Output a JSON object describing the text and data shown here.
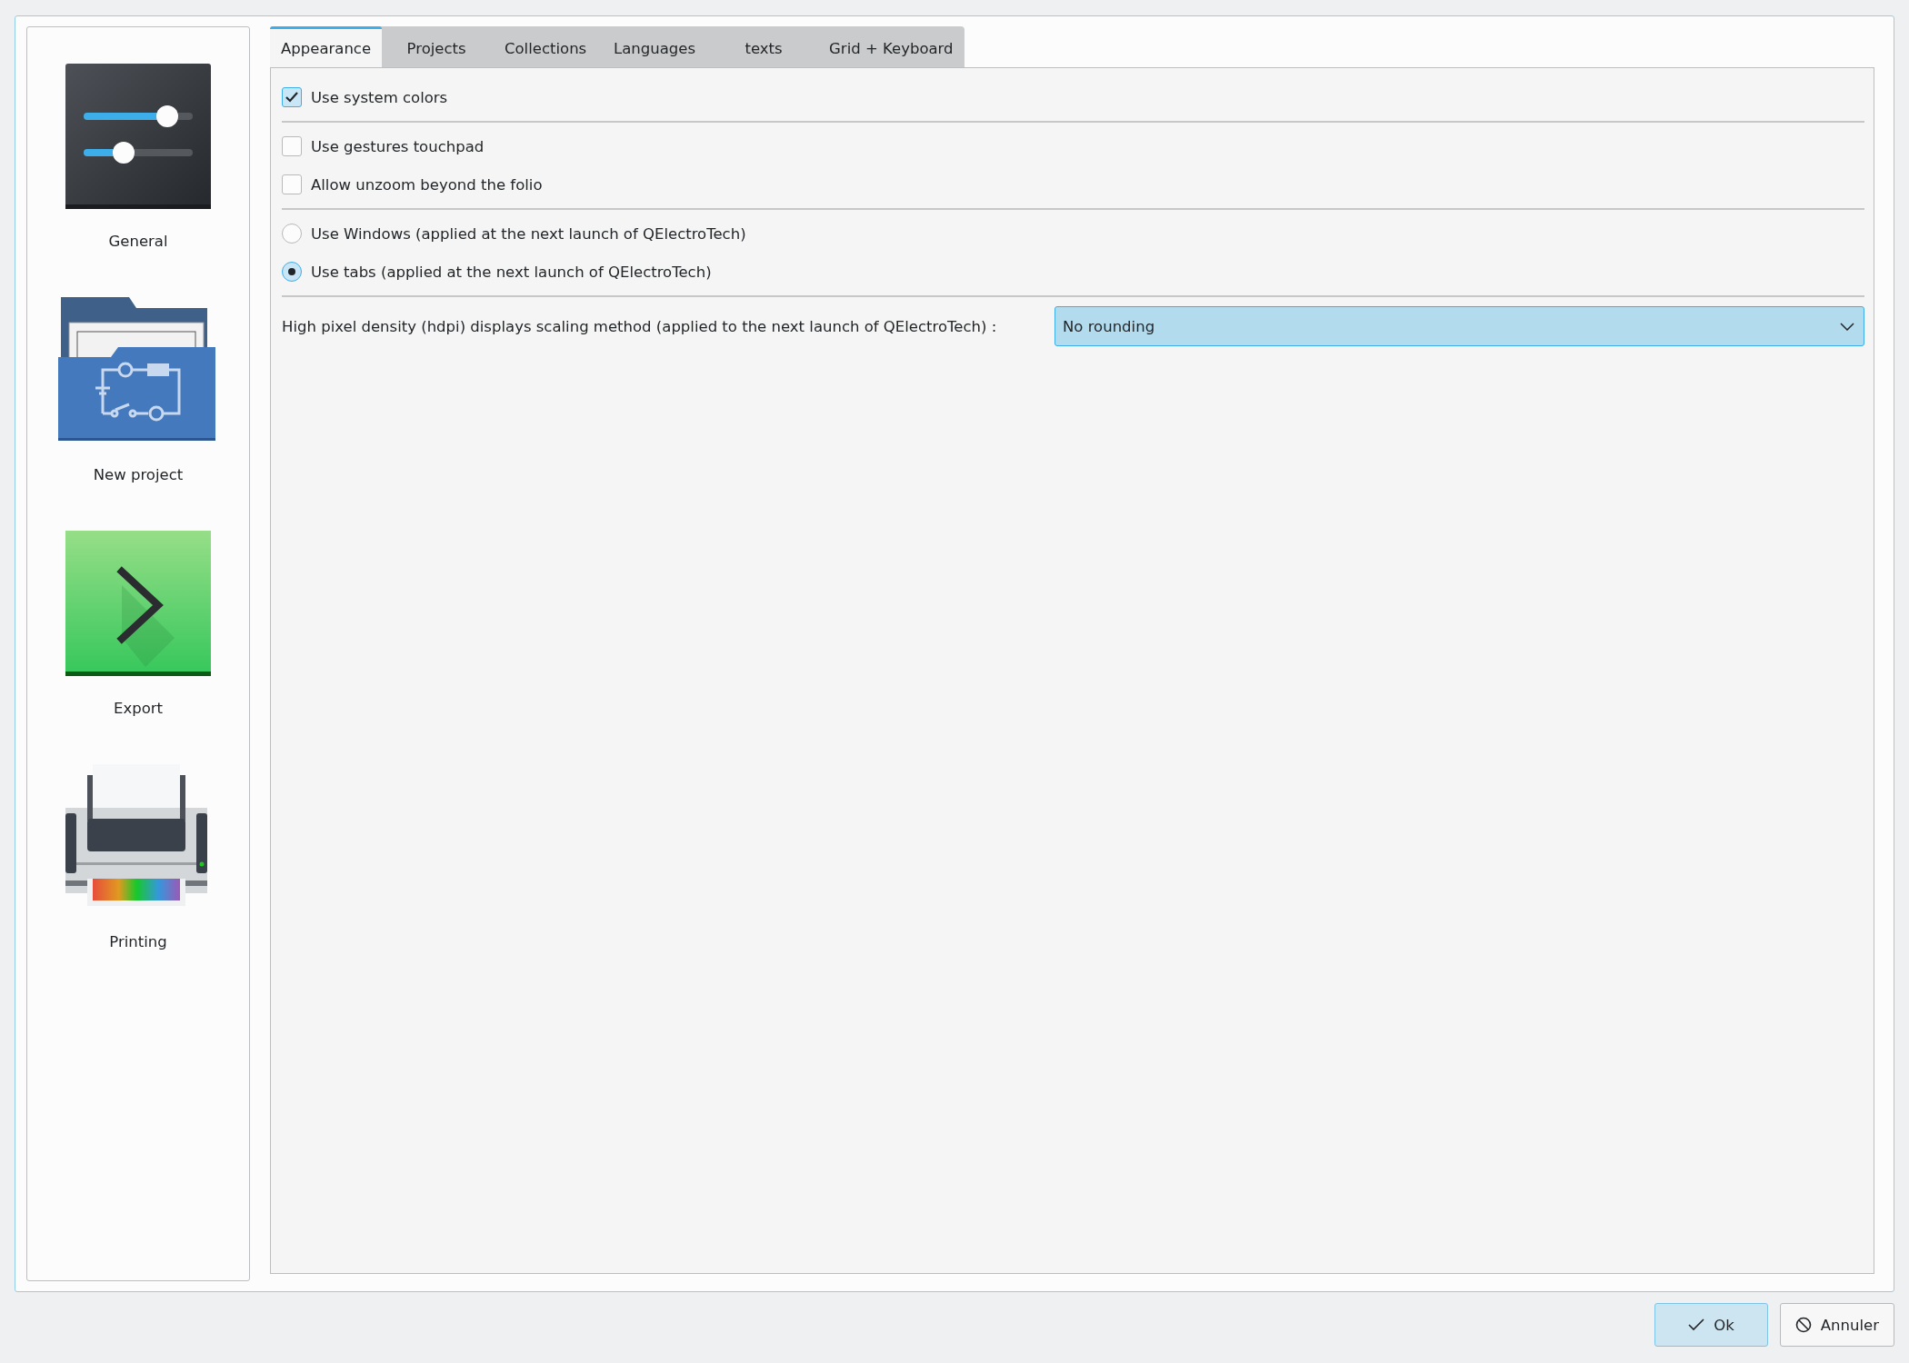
{
  "sidebar": {
    "items": [
      {
        "label": "General",
        "kind": "general"
      },
      {
        "label": "New project",
        "kind": "project"
      },
      {
        "label": "Export",
        "kind": "export"
      },
      {
        "label": "Printing",
        "kind": "printing"
      }
    ]
  },
  "tabs": [
    {
      "label": "Appearance",
      "selected": true
    },
    {
      "label": "Projects",
      "selected": false
    },
    {
      "label": "Collections",
      "selected": false
    },
    {
      "label": "Languages",
      "selected": false
    },
    {
      "label": "texts",
      "selected": false
    },
    {
      "label": "Grid + Keyboard",
      "selected": false
    }
  ],
  "sections": [
    {
      "items": [
        {
          "kind": "checkbox",
          "label": "Use system colors",
          "checked": true
        }
      ]
    },
    {
      "items": [
        {
          "kind": "checkbox",
          "label": "Use gestures touchpad",
          "checked": false
        },
        {
          "kind": "checkbox",
          "label": "Allow unzoom beyond the folio",
          "checked": false
        }
      ]
    },
    {
      "items": [
        {
          "kind": "radio",
          "label": "Use Windows (applied at the next launch of QElectroTech)",
          "selected": false
        },
        {
          "kind": "radio",
          "label": "Use tabs (applied at the next launch of QElectroTech)",
          "selected": true
        }
      ]
    }
  ],
  "scaling": {
    "label": "High pixel density (hdpi) displays scaling method (applied to the next launch of QElectroTech) :",
    "value": "No rounding"
  },
  "buttons": [
    {
      "label": "Ok",
      "kind": "ok",
      "default": true
    },
    {
      "label": "Annuler",
      "kind": "cancel",
      "default": false
    }
  ]
}
